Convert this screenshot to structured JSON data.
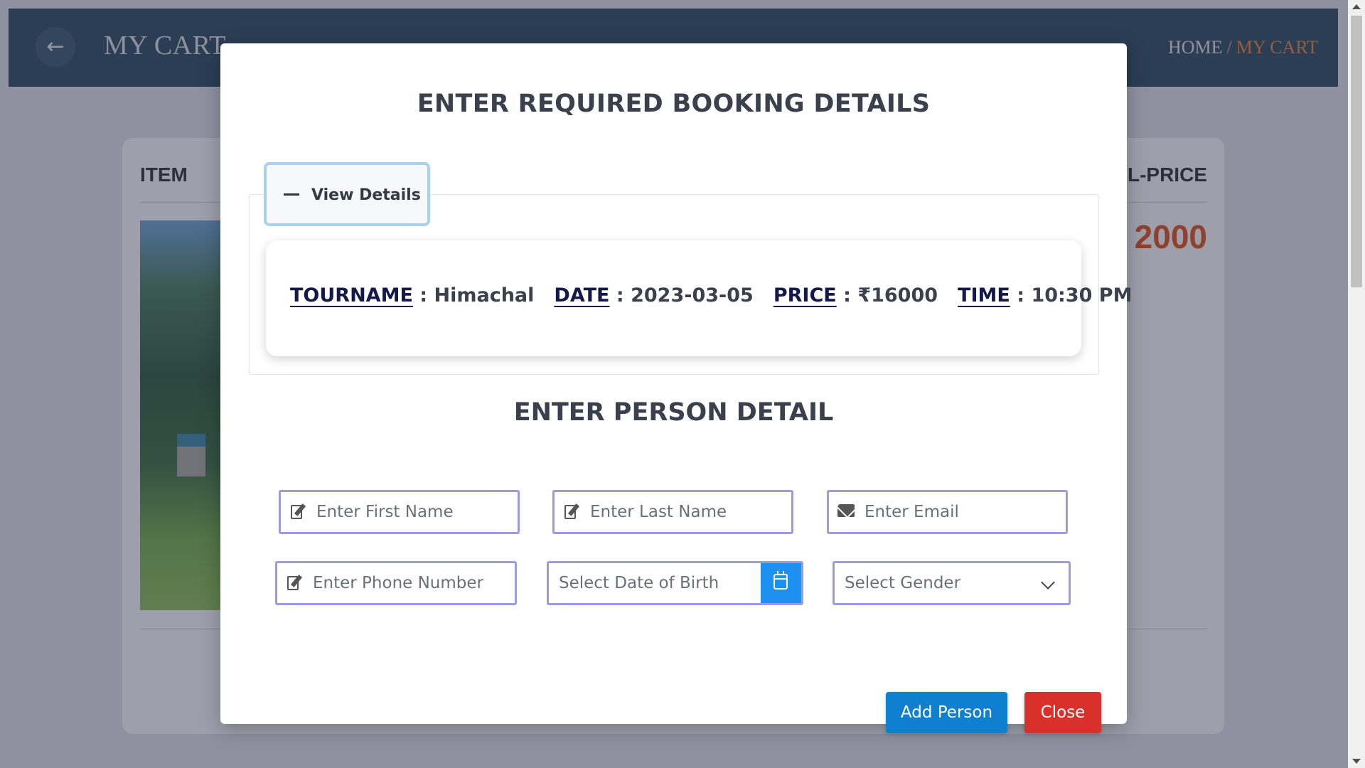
{
  "background": {
    "page_title": "MY CART",
    "breadcrumb": {
      "home": "HOME",
      "separator": "/",
      "current": "MY CART"
    },
    "cart": {
      "col_item": "ITEM",
      "col_total": "AL-PRICE",
      "total_value": "2000"
    }
  },
  "modal": {
    "title": "ENTER REQUIRED BOOKING DETAILS",
    "toggle_label": "View Details",
    "tour": [
      {
        "key": "TOURNAME",
        "sep": " : ",
        "value": "Himachal"
      },
      {
        "key": "DATE",
        "sep": " : ",
        "value": "2023-03-05"
      },
      {
        "key": "PRICE",
        "sep": " : ",
        "value": "₹16000"
      },
      {
        "key": "TIME",
        "sep": " : ",
        "value": "10:30 PM"
      }
    ],
    "person_title": "ENTER PERSON DETAIL",
    "fields": {
      "first_name": "Enter First Name",
      "last_name": "Enter Last Name",
      "email": "Enter Email",
      "phone": "Enter Phone Number",
      "dob": "Select Date of Birth",
      "gender": "Select Gender"
    },
    "buttons": {
      "add": "Add Person",
      "close": "Close"
    }
  },
  "colors": {
    "topbar": "#2f4f5f",
    "accent_orange": "#f0853a",
    "add_button": "#0f7fcf",
    "close_button": "#d9302c",
    "field_border": "#9a9be0",
    "calendar_button": "#1e90f0"
  },
  "icons": [
    "arrow-left-icon",
    "minus-icon",
    "edit-pen-icon",
    "envelope-icon",
    "calendar-icon",
    "chevron-down-icon"
  ]
}
